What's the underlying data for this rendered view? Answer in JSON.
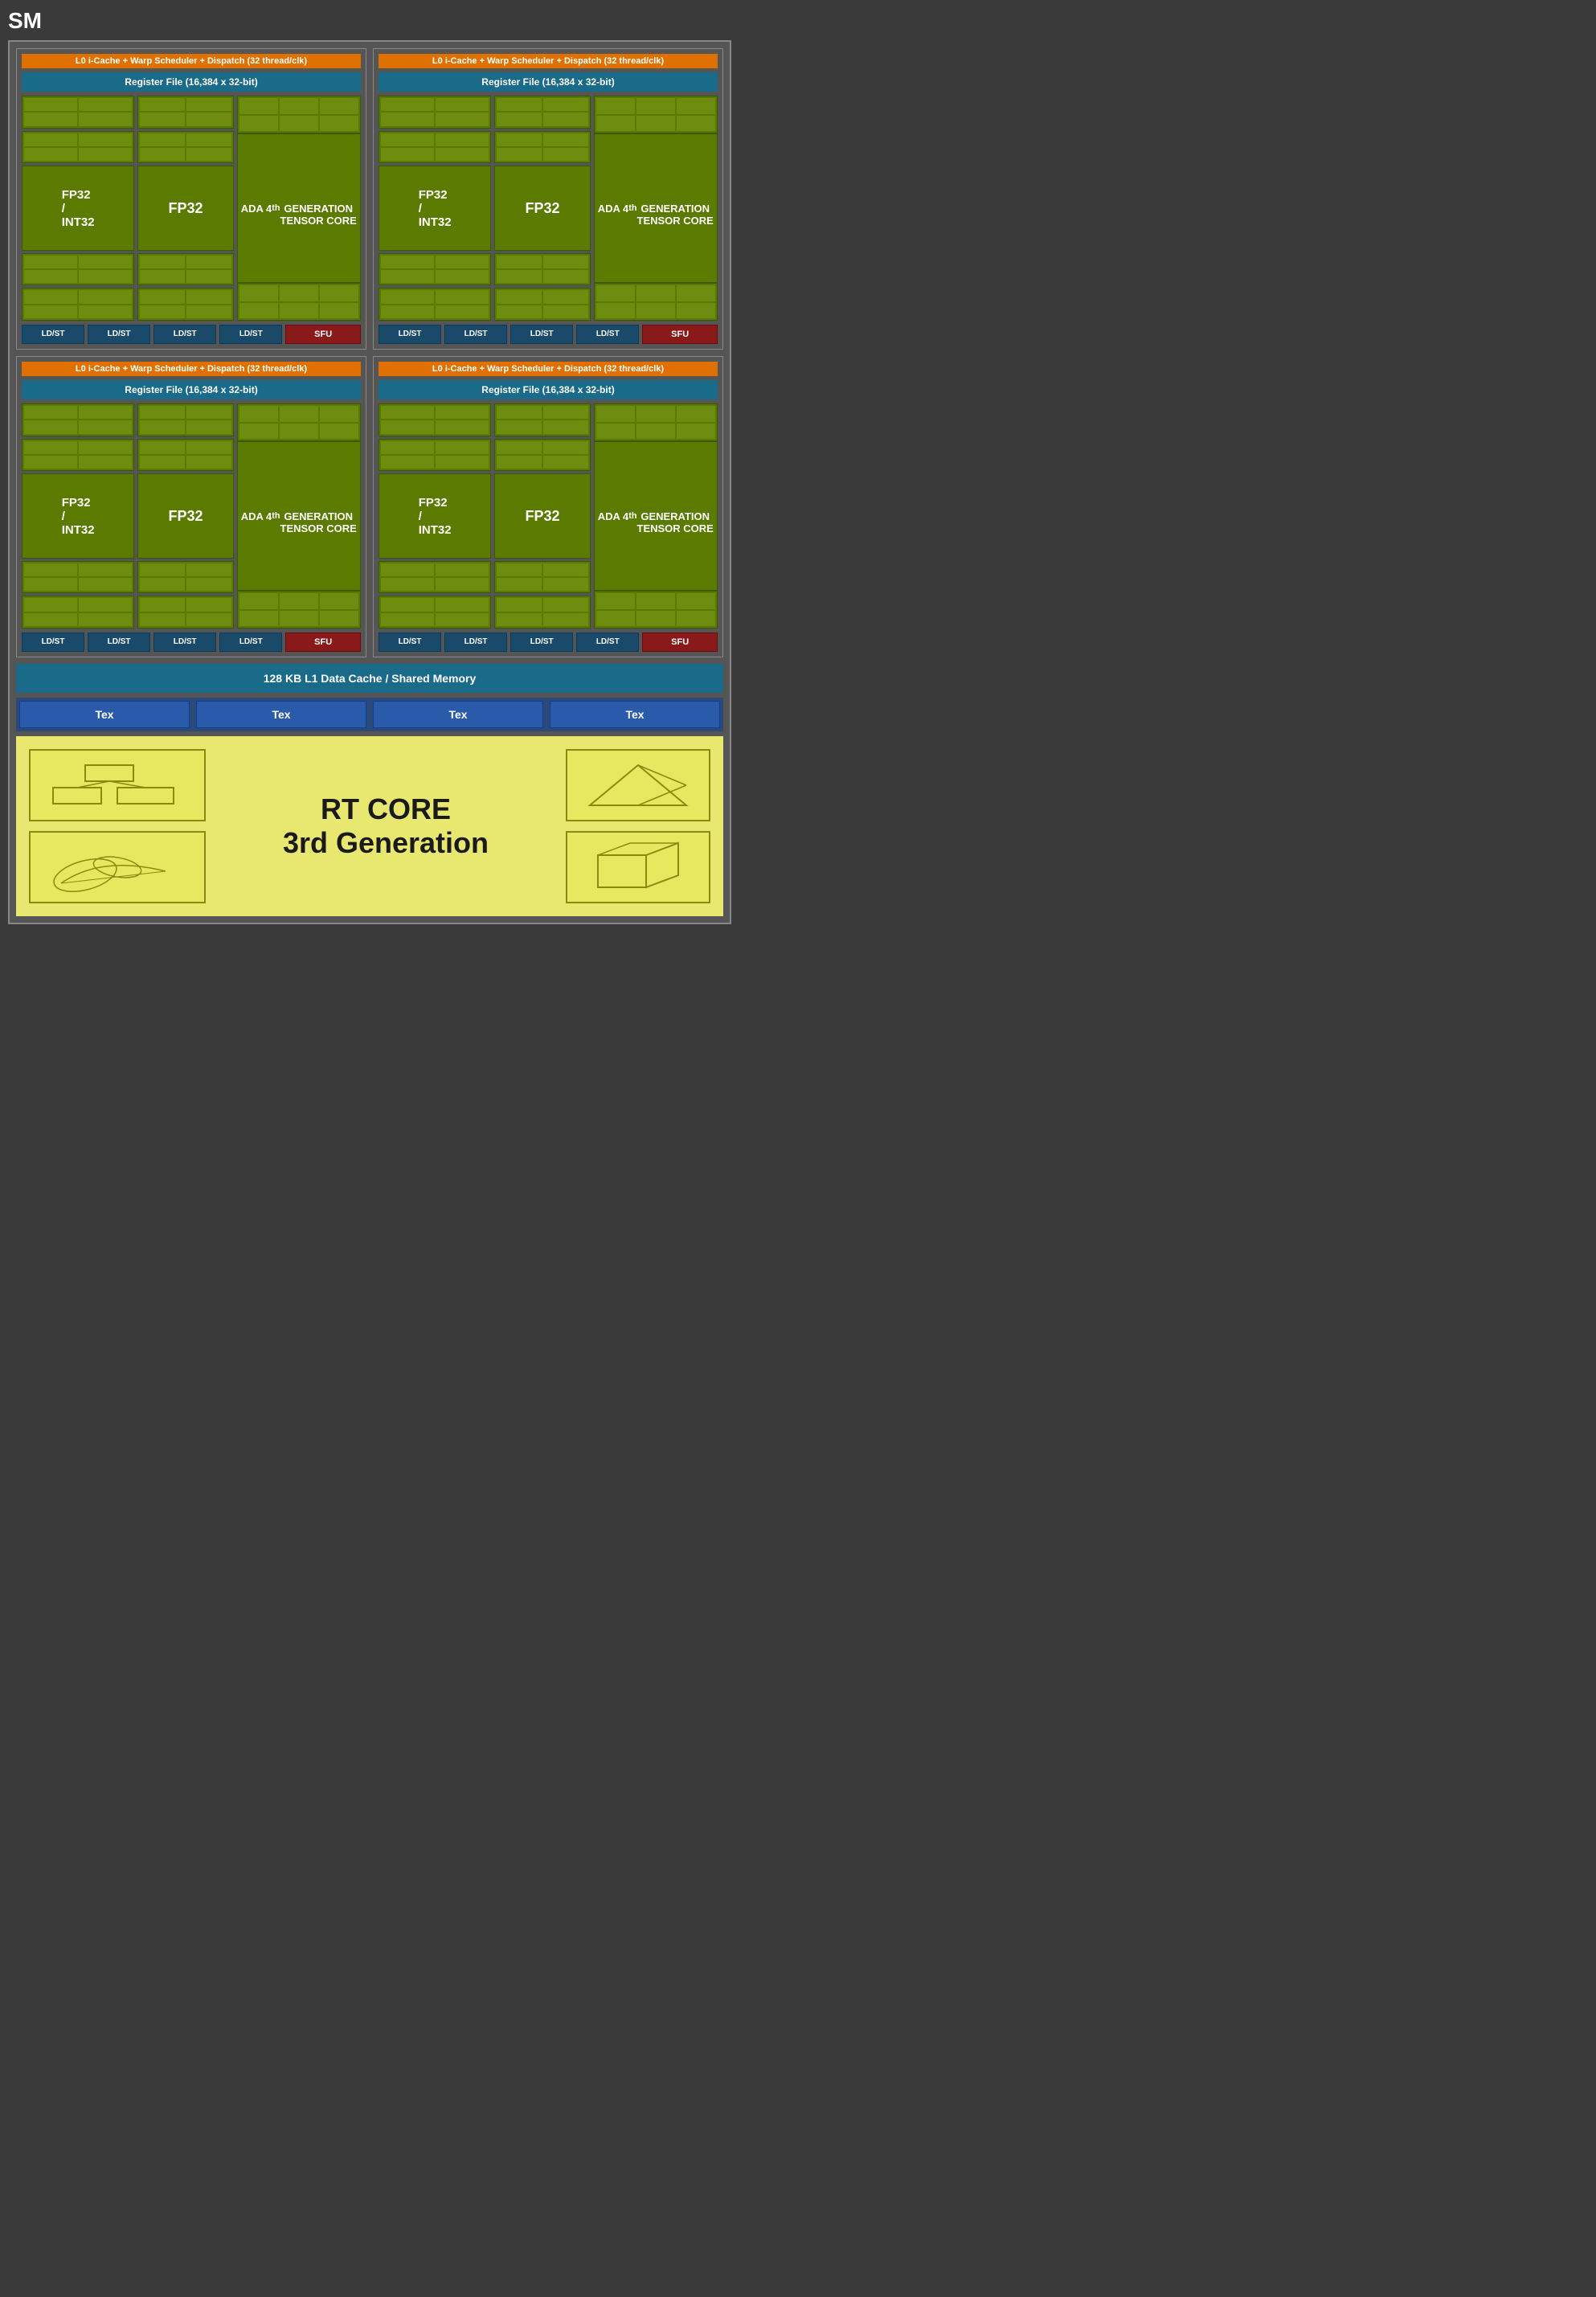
{
  "title": "SM",
  "l0_label": "L0 i-Cache + Warp Scheduler + Dispatch (32 thread/clk)",
  "reg_file_label": "Register File (16,384 x 32-bit)",
  "fp32_int32_label": "FP32\n/\nINT32",
  "fp32_label": "FP32",
  "tensor_label": "ADA 4th\nGENERATION\nTENSOR CORE",
  "ldst_label": "LD/ST",
  "sfu_label": "SFU",
  "l1_cache_label": "128 KB L1 Data Cache / Shared Memory",
  "tex_label": "Tex",
  "rt_core_line1": "RT CORE",
  "rt_core_line2": "3rd Generation",
  "colors": {
    "l0_bg": "#e07000",
    "reg_bg": "#1a6a8a",
    "green_bg": "#5a7a00",
    "ldst_bg": "#1a4a6a",
    "sfu_bg": "#8a1a1a",
    "l1_bg": "#1a6a8a",
    "tex_bg": "#2a5aaa",
    "rt_bg": "#e8e870"
  }
}
